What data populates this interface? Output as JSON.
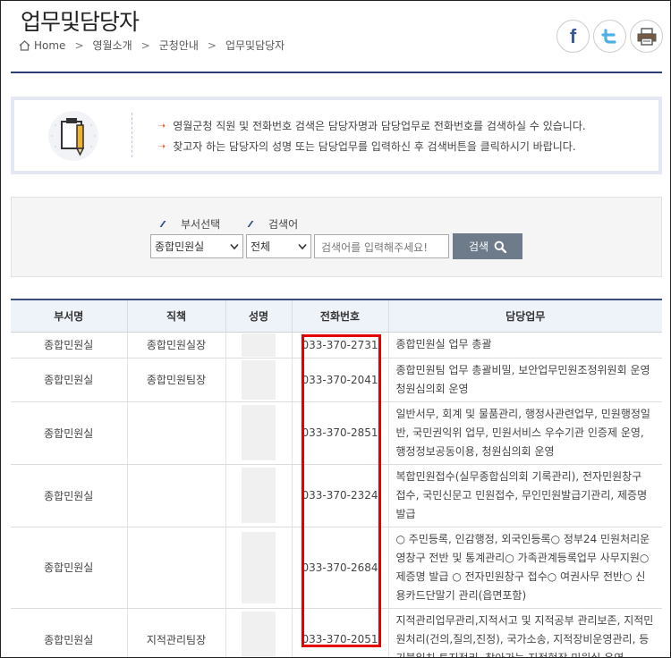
{
  "page": {
    "title": "업무및담당자"
  },
  "breadcrumb": [
    "Home",
    "영월소개",
    "군청안내",
    "업무및담당자"
  ],
  "share": {
    "facebook": "f"
  },
  "info": {
    "lines": [
      "영월군청 직원 및 전화번호 검색은 담당자명과 담당업무로 전화번호를 검색하실 수 있습니다.",
      "찾고자 하는 담당자의 성명 또는 담당업무를 입력하신 후 검색버튼을 클릭하시기 바랍니다."
    ]
  },
  "search": {
    "dept_label": "부서선택",
    "keyword_label": "검색어",
    "dept_value": "종합민원실",
    "kind_value": "전체",
    "placeholder": "검색어를 입력해주세요!",
    "button": "검색"
  },
  "table": {
    "headers": [
      "부서명",
      "직책",
      "성명",
      "전화번호",
      "담당업무"
    ],
    "rows": [
      {
        "dept": "종합민원실",
        "position": "종합민원실장",
        "phone": "033-370-2731",
        "duty": "종합민원실 업무 총괄"
      },
      {
        "dept": "종합민원실",
        "position": "종합민원팀장",
        "phone": "033-370-2041",
        "duty": "종합민원팀 업무 총괄비밀, 보안업무민원조정위원회 운영청원심의회 운영"
      },
      {
        "dept": "종합민원실",
        "position": "",
        "phone": "033-370-2851",
        "duty": "일반서무, 회계 및 물품관리, 행정사관련업무, 민원행정일반, 국민권익위 업무, 민원서비스 우수기관 인증제 운영, 행정정보공동이용, 청원심의회 운영"
      },
      {
        "dept": "종합민원실",
        "position": "",
        "phone": "033-370-2324",
        "duty": "복합민원접수(실무종합심의회 기록관리), 전자민원창구 접수, 국민신문고 민원접수, 무인민원발급기관리, 제증명 발급"
      },
      {
        "dept": "종합민원실",
        "position": "",
        "phone": "033-370-2684",
        "duty": "○ 주민등록, 인감행정, 외국인등록○ 정부24 민원처리운영창구 전반 및 통계관리○ 가족관계등록업무 사무지원○ 제증명 발급 ○ 전자민원창구 접수○ 여권사무 전반○ 신용카드단말기 관리(읍면포함)"
      },
      {
        "dept": "종합민원실",
        "position": "지적관리팀장",
        "phone": "033-370-2051",
        "duty": "지적관리업무관리,지적서고 및 지적공부 관리보존, 지적민원처리(건의,질의,진정), 국가소송, 지적장비운영관리, 등기불일치 토지정리, 찾아가는 지적현장 민원실 운영"
      }
    ]
  },
  "colors": {
    "accent": "#2c3d73",
    "highlight": "#e50000",
    "button": "#6e7b8b"
  }
}
